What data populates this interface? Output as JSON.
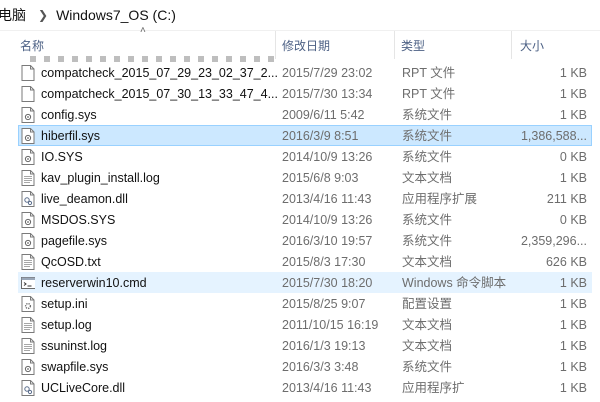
{
  "breadcrumb": {
    "computer": "电脑",
    "drive": "Windows7_OS (C:)"
  },
  "columns": {
    "name": "名称",
    "date": "修改日期",
    "type": "类型",
    "size": "大小"
  },
  "files": [
    {
      "name": "compatcheck_2015_07_29_23_02_37_2...",
      "date": "2015/7/29 23:02",
      "type": "RPT 文件",
      "size": "1 KB",
      "icon": "document-icon"
    },
    {
      "name": "compatcheck_2015_07_30_13_33_47_4...",
      "date": "2015/7/30 13:34",
      "type": "RPT 文件",
      "size": "1 KB",
      "icon": "document-icon"
    },
    {
      "name": "config.sys",
      "date": "2009/6/11 5:42",
      "type": "系统文件",
      "size": "1 KB",
      "icon": "system-file-icon"
    },
    {
      "name": "hiberfil.sys",
      "date": "2016/3/9 8:51",
      "type": "系统文件",
      "size": "1,386,588...",
      "icon": "system-file-icon"
    },
    {
      "name": "IO.SYS",
      "date": "2014/10/9 13:26",
      "type": "系统文件",
      "size": "0 KB",
      "icon": "system-file-icon"
    },
    {
      "name": "kav_plugin_install.log",
      "date": "2015/6/8 9:03",
      "type": "文本文档",
      "size": "1 KB",
      "icon": "text-document-icon"
    },
    {
      "name": "live_deamon.dll",
      "date": "2013/4/16 11:43",
      "type": "应用程序扩展",
      "size": "211 KB",
      "icon": "dll-file-icon"
    },
    {
      "name": "MSDOS.SYS",
      "date": "2014/10/9 13:26",
      "type": "系统文件",
      "size": "0 KB",
      "icon": "system-file-icon"
    },
    {
      "name": "pagefile.sys",
      "date": "2016/3/10 19:57",
      "type": "系统文件",
      "size": "2,359,296...",
      "icon": "system-file-icon"
    },
    {
      "name": "QcOSD.txt",
      "date": "2015/8/3 17:30",
      "type": "文本文档",
      "size": "626 KB",
      "icon": "text-document-icon"
    },
    {
      "name": "reserverwin10.cmd",
      "date": "2015/7/30 18:20",
      "type": "Windows 命令脚本",
      "size": "1 KB",
      "icon": "cmd-script-icon"
    },
    {
      "name": "setup.ini",
      "date": "2015/8/25 9:07",
      "type": "配置设置",
      "size": "1 KB",
      "icon": "config-file-icon"
    },
    {
      "name": "setup.log",
      "date": "2011/10/15 16:19",
      "type": "文本文档",
      "size": "1 KB",
      "icon": "text-document-icon"
    },
    {
      "name": "ssuninst.log",
      "date": "2016/1/3 19:13",
      "type": "文本文档",
      "size": "1 KB",
      "icon": "text-document-icon"
    },
    {
      "name": "swapfile.sys",
      "date": "2016/3/3 3:48",
      "type": "系统文件",
      "size": "1 KB",
      "icon": "system-file-icon"
    },
    {
      "name": "UCLiveCore.dll",
      "date": "2013/4/16 11:43",
      "type": "应用程序扩",
      "size": "1 KB",
      "icon": "dll-file-icon"
    }
  ],
  "selected_index": 3,
  "hover_index": 10,
  "colors": {
    "selection_bg": "#cce8ff",
    "selection_border": "#99d1ff",
    "hover_bg": "#e5f3ff",
    "header_text": "#4d6185"
  }
}
